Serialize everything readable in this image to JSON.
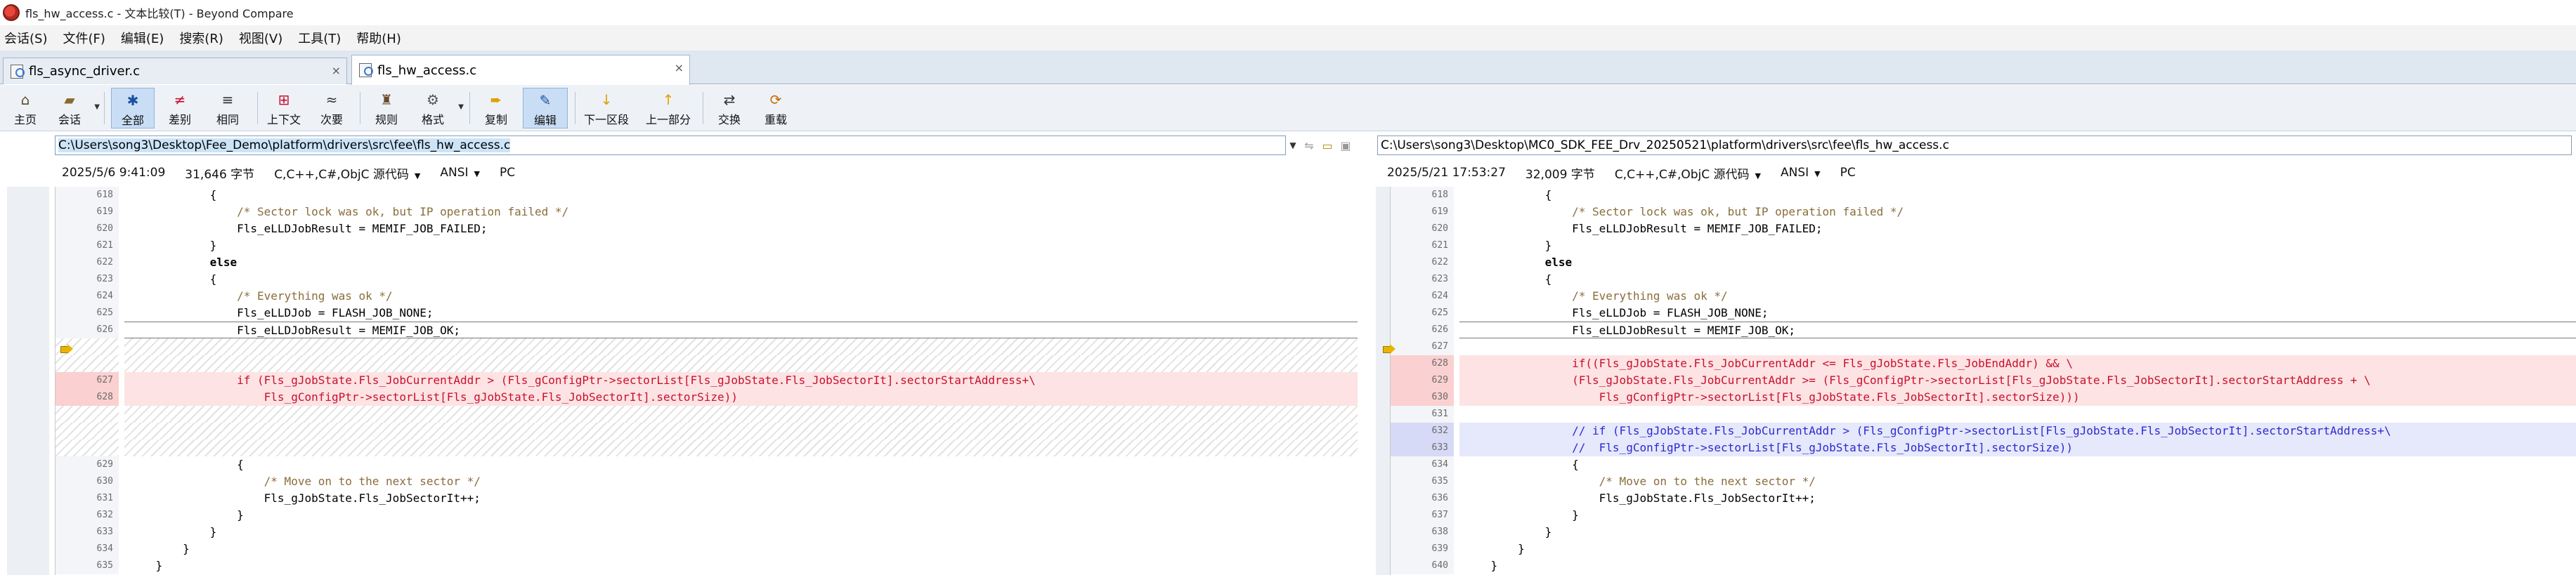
{
  "window": {
    "title": "fls_hw_access.c - 文本比较(T) - Beyond Compare"
  },
  "menu": [
    "会话(S)",
    "文件(F)",
    "编辑(E)",
    "搜索(R)",
    "视图(V)",
    "工具(T)",
    "帮助(H)"
  ],
  "tabs": [
    {
      "label": "fls_async_driver.c",
      "close": "×"
    },
    {
      "label": "fls_hw_access.c",
      "close": "×"
    }
  ],
  "toolbar": {
    "home": "主页",
    "session": "会话",
    "all": "全部",
    "diffs": "差别",
    "same": "相同",
    "context": "上下文",
    "minor": "次要",
    "rules": "规则",
    "format": "格式",
    "copy": "复制",
    "edit": "编辑",
    "next_section": "下一区段",
    "prev_part": "上一部分",
    "swap": "交换",
    "reload": "重载"
  },
  "left": {
    "path": "C:\\Users\\song3\\Desktop\\Fee_Demo\\platform\\drivers\\src\\fee\\fls_hw_access.c",
    "date": "2025/5/6 9:41:09",
    "size": "31,646 字节",
    "lang": "C,C++,C#,ObjC 源代码",
    "encoding": "ANSI",
    "eol": "PC",
    "lines": [
      {
        "n": "618",
        "t": "            {",
        "k": "n"
      },
      {
        "n": "619",
        "t": "                /* Sector lock was ok, but IP operation failed */",
        "k": "n"
      },
      {
        "n": "620",
        "t": "                Fls_eLLDJobResult = MEMIF_JOB_FAILED;",
        "k": "n"
      },
      {
        "n": "621",
        "t": "            }",
        "k": "n"
      },
      {
        "n": "622",
        "t": "            else",
        "k": "n"
      },
      {
        "n": "623",
        "t": "            {",
        "k": "n"
      },
      {
        "n": "624",
        "t": "                /* Everything was ok */",
        "k": "n"
      },
      {
        "n": "625",
        "t": "                Fls_eLLDJob = FLASH_JOB_NONE;",
        "k": "n"
      },
      {
        "n": "626",
        "t": "                Fls_eLLDJobResult = MEMIF_JOB_OK;",
        "k": "n"
      },
      {
        "n": "",
        "t": "",
        "k": "h"
      },
      {
        "n": "",
        "t": "",
        "k": "h"
      },
      {
        "n": "627",
        "t": "                if (Fls_gJobState.Fls_JobCurrentAddr > (Fls_gConfigPtr->sectorList[Fls_gJobState.Fls_JobSectorIt].sectorStartAddress+\\",
        "k": "d"
      },
      {
        "n": "628",
        "t": "                    Fls_gConfigPtr->sectorList[Fls_gJobState.Fls_JobSectorIt].sectorSize))",
        "k": "d"
      },
      {
        "n": "",
        "t": "",
        "k": "h"
      },
      {
        "n": "",
        "t": "",
        "k": "h"
      },
      {
        "n": "",
        "t": "",
        "k": "h"
      },
      {
        "n": "629",
        "t": "                {",
        "k": "n"
      },
      {
        "n": "630",
        "t": "                    /* Move on to the next sector */",
        "k": "n"
      },
      {
        "n": "631",
        "t": "                    Fls_gJobState.Fls_JobSectorIt++;",
        "k": "n"
      },
      {
        "n": "632",
        "t": "                }",
        "k": "n"
      },
      {
        "n": "633",
        "t": "            }",
        "k": "n"
      },
      {
        "n": "634",
        "t": "        }",
        "k": "n"
      },
      {
        "n": "635",
        "t": "    }",
        "k": "n"
      }
    ]
  },
  "right": {
    "path": "C:\\Users\\song3\\Desktop\\MC0_SDK_FEE_Drv_20250521\\platform\\drivers\\src\\fee\\fls_hw_access.c",
    "date": "2025/5/21 17:53:27",
    "size": "32,009 字节",
    "lang": "C,C++,C#,ObjC 源代码",
    "encoding": "ANSI",
    "eol": "PC",
    "lines": [
      {
        "n": "618",
        "t": "            {",
        "k": "n"
      },
      {
        "n": "619",
        "t": "                /* Sector lock was ok, but IP operation failed */",
        "k": "n"
      },
      {
        "n": "620",
        "t": "                Fls_eLLDJobResult = MEMIF_JOB_FAILED;",
        "k": "n"
      },
      {
        "n": "621",
        "t": "            }",
        "k": "n"
      },
      {
        "n": "622",
        "t": "            else",
        "k": "n"
      },
      {
        "n": "623",
        "t": "            {",
        "k": "n"
      },
      {
        "n": "624",
        "t": "                /* Everything was ok */",
        "k": "n"
      },
      {
        "n": "625",
        "t": "                Fls_eLLDJob = FLASH_JOB_NONE;",
        "k": "n"
      },
      {
        "n": "626",
        "t": "                Fls_eLLDJobResult = MEMIF_JOB_OK;",
        "k": "n"
      },
      {
        "n": "627",
        "t": "",
        "k": "n"
      },
      {
        "n": "628",
        "t": "                if((Fls_gJobState.Fls_JobCurrentAddr <= Fls_gJobState.Fls_JobEndAddr) && \\",
        "k": "d"
      },
      {
        "n": "629",
        "t": "                (Fls_gJobState.Fls_JobCurrentAddr >= (Fls_gConfigPtr->sectorList[Fls_gJobState.Fls_JobSectorIt].sectorStartAddress + \\",
        "k": "d"
      },
      {
        "n": "630",
        "t": "                    Fls_gConfigPtr->sectorList[Fls_gJobState.Fls_JobSectorIt].sectorSize)))",
        "k": "d"
      },
      {
        "n": "631",
        "t": "",
        "k": "n"
      },
      {
        "n": "632",
        "t": "                // if (Fls_gJobState.Fls_JobCurrentAddr > (Fls_gConfigPtr->sectorList[Fls_gJobState.Fls_JobSectorIt].sectorStartAddress+\\",
        "k": "b"
      },
      {
        "n": "633",
        "t": "                //  Fls_gConfigPtr->sectorList[Fls_gJobState.Fls_JobSectorIt].sectorSize))",
        "k": "b"
      },
      {
        "n": "634",
        "t": "                {",
        "k": "n"
      },
      {
        "n": "635",
        "t": "                    /* Move on to the next sector */",
        "k": "n"
      },
      {
        "n": "636",
        "t": "                    Fls_gJobState.Fls_JobSectorIt++;",
        "k": "n"
      },
      {
        "n": "637",
        "t": "                }",
        "k": "n"
      },
      {
        "n": "638",
        "t": "            }",
        "k": "n"
      },
      {
        "n": "639",
        "t": "        }",
        "k": "n"
      },
      {
        "n": "640",
        "t": "    }",
        "k": "n"
      }
    ]
  }
}
